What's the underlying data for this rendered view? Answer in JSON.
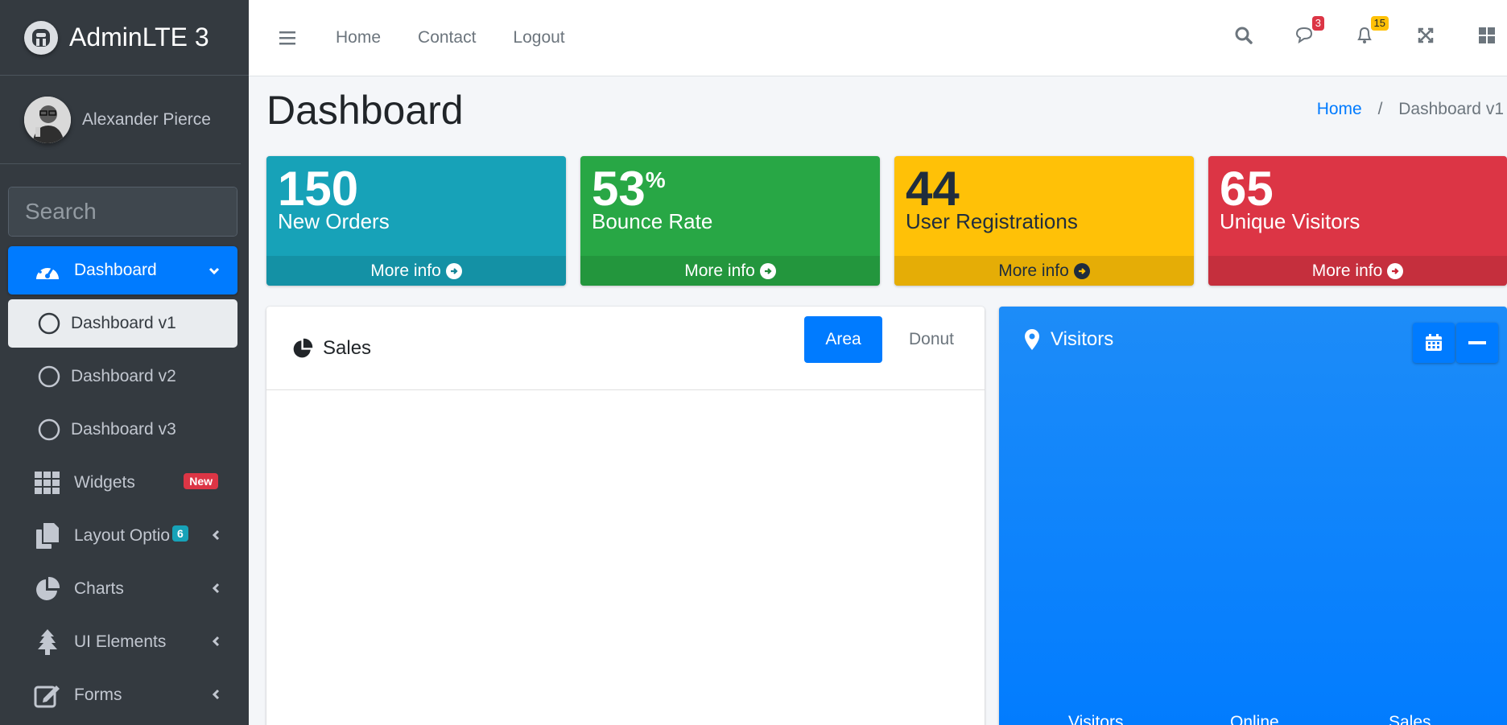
{
  "brand": {
    "name": "AdminLTE 3"
  },
  "user": {
    "name": "Alexander Pierce"
  },
  "sidebar_search": {
    "placeholder": "Search"
  },
  "sidebar": {
    "items": [
      {
        "label": "Dashboard",
        "icon": "tachometer-icon"
      },
      {
        "label": "Dashboard v1",
        "icon": "circle-icon"
      },
      {
        "label": "Dashboard v2",
        "icon": "circle-icon"
      },
      {
        "label": "Dashboard v3",
        "icon": "circle-icon"
      },
      {
        "label": "Widgets",
        "icon": "th-icon",
        "badge": "New"
      },
      {
        "label": "Layout Options",
        "icon": "copy-icon",
        "badge": "6"
      },
      {
        "label": "Charts",
        "icon": "pie-chart-icon"
      },
      {
        "label": "UI Elements",
        "icon": "tree-icon"
      },
      {
        "label": "Forms",
        "icon": "edit-icon"
      }
    ]
  },
  "navbar": {
    "links": [
      "Home",
      "Contact",
      "Logout"
    ],
    "messages_count": "3",
    "notifications_count": "15"
  },
  "page": {
    "title": "Dashboard",
    "breadcrumb": [
      "Home",
      "Dashboard v1"
    ]
  },
  "small_boxes": [
    {
      "value": "150",
      "label": "New Orders",
      "footer": "More info",
      "color": "#17a2b8"
    },
    {
      "value": "53",
      "suffix": "%",
      "label": "Bounce Rate",
      "footer": "More info",
      "color": "#28a745"
    },
    {
      "value": "44",
      "label": "User Registrations",
      "footer": "More info",
      "color": "#ffc107"
    },
    {
      "value": "65",
      "label": "Unique Visitors",
      "footer": "More info",
      "color": "#dc3545"
    }
  ],
  "sales_card": {
    "title": "Sales",
    "tabs": [
      "Area",
      "Donut"
    ],
    "active_tab": "Area"
  },
  "visitors_card": {
    "title": "Visitors",
    "footer_labels": [
      "Visitors",
      "Online",
      "Sales"
    ]
  },
  "colors": {
    "primary": "#007bff",
    "sidebar_bg": "#343a40",
    "info": "#17a2b8",
    "success": "#28a745",
    "warning": "#ffc107",
    "danger": "#dc3545"
  }
}
